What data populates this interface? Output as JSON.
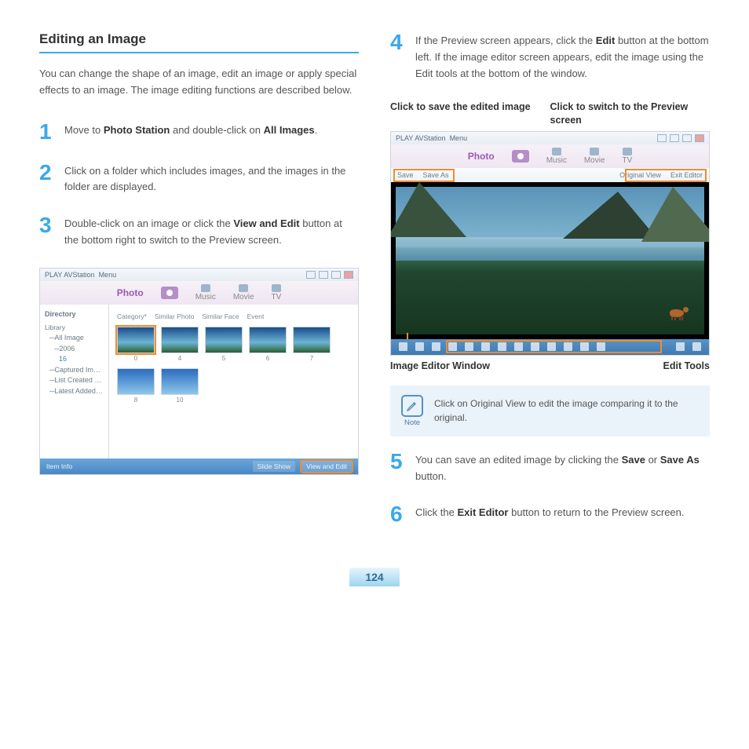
{
  "pageNumber": "124",
  "left": {
    "heading": "Editing an Image",
    "intro": "You can change the shape of an image, edit an image or apply special effects to an image. The image editing functions are described below.",
    "steps": {
      "s1num": "1",
      "s1a": "Move to ",
      "s1b": "Photo Station",
      "s1c": " and double-click on ",
      "s1d": "All Images",
      "s1e": ".",
      "s2num": "2",
      "s2": "Click on a folder which includes images, and the images in the folder are displayed.",
      "s3num": "3",
      "s3a": "Double-click on an image or click the ",
      "s3b": "View and Edit",
      "s3c": " button at the bottom right to switch to the Preview screen."
    },
    "app": {
      "title": "PLAY AVStation",
      "menu": "Menu",
      "tabs": {
        "photo": "Photo",
        "music": "Music",
        "movie": "Movie",
        "tv": "TV"
      },
      "side": {
        "header": "Directory",
        "i0": "Library",
        "i1": "All Image",
        "i2": "2006",
        "i3": "16",
        "i4": "Captured Image",
        "i5": "List Created by Me",
        "i6": "Latest Added List"
      },
      "tbar": {
        "a": "Category*",
        "b": "Similar Photo",
        "c": "Similar Face",
        "d": "Event"
      },
      "caps": {
        "c1": "0",
        "c2": "4",
        "c3": "5",
        "c4": "6",
        "c5": "7",
        "c6": "8",
        "c7": "10"
      },
      "footer": {
        "item": "Item Info",
        "slide": "Slide Show",
        "view": "View and Edit"
      }
    }
  },
  "right": {
    "steps": {
      "s4num": "4",
      "s4a": "If the Preview screen appears, click the ",
      "s4b": "Edit",
      "s4c": " button at the bottom left. If the image editor screen appears, edit the image using the Edit tools at the bottom of the window.",
      "s5num": "5",
      "s5a": "You can save an edited image by clicking the ",
      "s5b": "Save",
      "s5c": " or ",
      "s5d": "Save As",
      "s5e": " button.",
      "s6num": "6",
      "s6a": "Click the ",
      "s6b": "Exit Editor",
      "s6c": " button to return to the Preview screen."
    },
    "callouts": {
      "cl1": "Click to save the edited image",
      "cl2": "Click to switch to the Preview screen",
      "lbl1": "Image Editor Window",
      "lbl2": "Edit Tools"
    },
    "app": {
      "title": "PLAY AVStation",
      "menu": "Menu",
      "tabs": {
        "photo": "Photo",
        "music": "Music",
        "movie": "Movie",
        "tv": "TV"
      },
      "toolbar": {
        "save": "Save",
        "saveas": "Save As",
        "orig": "Original View",
        "exit": "Exit Editor"
      }
    },
    "note": {
      "label": "Note",
      "text": "Click on Original View to edit the image comparing it to the original."
    }
  }
}
